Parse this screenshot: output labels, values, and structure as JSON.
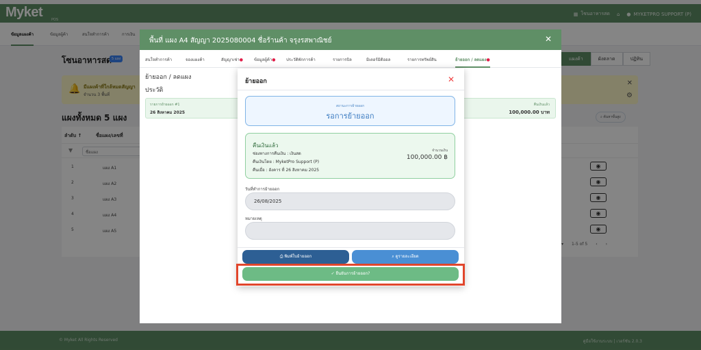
{
  "app": {
    "logo": "Myket",
    "logo_sub": "POS",
    "topbar_link": "โซนอาหารสด",
    "user": "MYKETPRO SUPPORT (P)"
  },
  "page_tabs": [
    "ข้อมูลแผงค้า",
    "ข้อมูลผู้ค้า",
    "สนใจทำการค้า",
    "การเงิน"
  ],
  "zone": {
    "title": "โซนอาหารสด",
    "badge": "5 แผง"
  },
  "top_buttons": [
    "แผงค้า",
    "ผังตลาด",
    "ปฏิทิน"
  ],
  "alert": {
    "line1": "มีแผงค้าที่ใกล้หมดสัญญา",
    "line2": "จำนวน 3 พื้นที่"
  },
  "list_title": "แผงทั้งหมด 5 แผง",
  "search_chip": "ค้นหาขั้นสูง",
  "table": {
    "headers": [
      "ลำดับ ↑",
      "ชื่อแผง/เลขที่"
    ],
    "filter_placeholder": "ชื่อแผง",
    "rows": [
      {
        "n": "1",
        "name": "แผง A1"
      },
      {
        "n": "2",
        "name": "แผง A2"
      },
      {
        "n": "3",
        "name": "แผง A3"
      },
      {
        "n": "4",
        "name": "แผง A4"
      },
      {
        "n": "5",
        "name": "แผง A5"
      }
    ],
    "pager": "1-5 of 5"
  },
  "footer": {
    "left": "© Myket All Rights Reserved",
    "right": "คู่มือใช้งานระบบ | เวอร์ชัน 2.0.3"
  },
  "modal1": {
    "title": "พื้นที่ แผง A4 สัญญา 2025080004 ชื่อร้านค้า จรุงรสพาณิชย์",
    "tabs": [
      {
        "label": "สนใจทำการค้า",
        "dot": ""
      },
      {
        "label": "จองแผงค้า",
        "dot": ""
      },
      {
        "label": "สัญญาเช่า",
        "dot": "●"
      },
      {
        "label": "ข้อมูลผู้ค้า",
        "dot": "●"
      },
      {
        "label": "ประวัติพักการค้า",
        "dot": ""
      },
      {
        "label": "รายการบิล",
        "dot": ""
      },
      {
        "label": "มิเตอร์มิติออล",
        "dot": ""
      },
      {
        "label": "รายการทรัพย์สิน",
        "dot": ""
      },
      {
        "label": "ย้ายออก / ลดแผง",
        "dot": "●"
      }
    ],
    "section1": "ย้ายออก / ลดแผง",
    "section2": "ประวัติ",
    "card": {
      "label": "รายการย้ายออก #1",
      "date": "26 สิงหาคม 2025",
      "amount_label": "คืนเงินแล้ว",
      "amount": "100,000.00 บาท"
    }
  },
  "modal2": {
    "title": "ย้ายออก",
    "status_label": "สถานะการย้ายออก",
    "status_value": "รอการย้ายออก",
    "refund": {
      "title": "คืนเงินแล้ว",
      "method": "ช่องทางการคืนเงิน : เงินสด",
      "by": "คืนเงินโดย : MyketPro Support (P)",
      "when": "คืนเมื่อ : อังคาร ที่ 26 สิงหาคม 2025",
      "amount_label": "จำนวนเงิน",
      "amount": "100,000.00 ฿"
    },
    "date_label": "วันที่ทำการย้ายออก",
    "date_value": "26/08/2025",
    "note_label": "หมายเหตุ",
    "note_value": "",
    "print_btn": "พิมพ์ใบย้ายออก",
    "detail_btn": "ดูรายละเอียด",
    "confirm_btn": "ยืนยันการย้ายออก?"
  }
}
